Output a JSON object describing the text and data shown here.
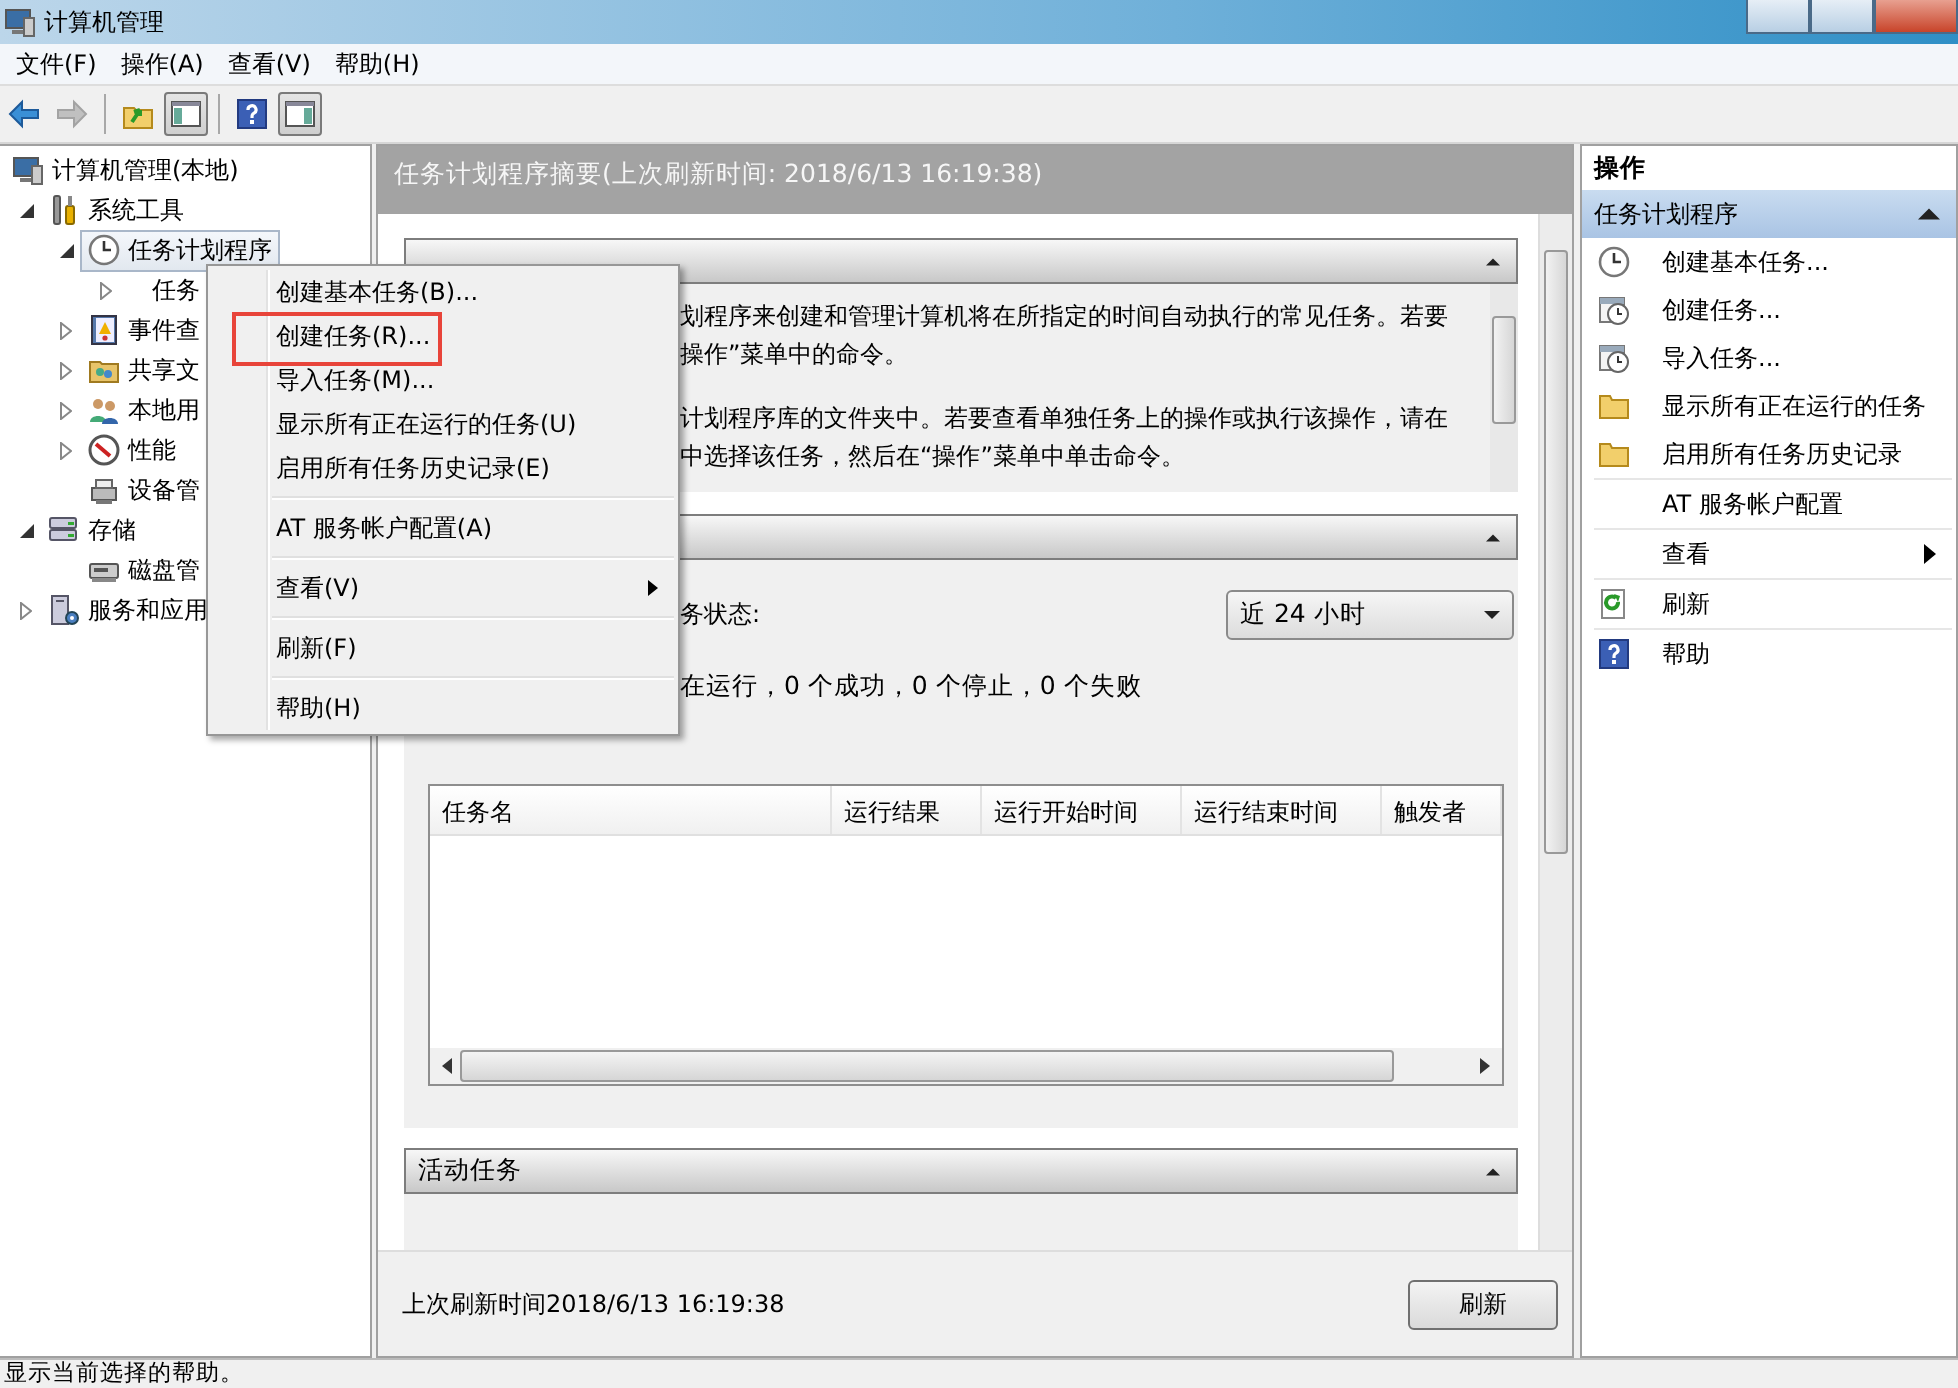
{
  "window": {
    "title": "计算机管理"
  },
  "menu_bar": [
    "文件(F)",
    "操作(A)",
    "查看(V)",
    "帮助(H)"
  ],
  "toolbar": [
    {
      "kind": "back",
      "disabled": false,
      "pressed": false
    },
    {
      "kind": "forward",
      "disabled": true,
      "pressed": false
    },
    {
      "kind": "separator"
    },
    {
      "kind": "up",
      "disabled": false,
      "pressed": false
    },
    {
      "kind": "tree-toggle",
      "disabled": false,
      "pressed": true
    },
    {
      "kind": "separator"
    },
    {
      "kind": "help",
      "disabled": false,
      "pressed": false
    },
    {
      "kind": "pane-toggle",
      "disabled": false,
      "pressed": true
    }
  ],
  "tree": [
    {
      "label": "计算机管理(本地)",
      "selected": false,
      "children": [
        {
          "label": "系统工具",
          "expanded": true,
          "selected": false,
          "children": [
            {
              "label": "任务计划程序",
              "expanded": true,
              "selected": true,
              "children": [
                {
                  "label": "任务",
                  "expanded": false,
                  "selected": false
                }
              ]
            },
            {
              "label": "事件查",
              "expanded": false,
              "selected": false
            },
            {
              "label": "共享文",
              "expanded": false,
              "selected": false
            },
            {
              "label": "本地用",
              "expanded": false,
              "selected": false
            },
            {
              "label": "性能",
              "expanded": false,
              "selected": false
            },
            {
              "label": "设备管",
              "selected": false
            }
          ]
        },
        {
          "label": "存储",
          "expanded": true,
          "selected": false,
          "children": [
            {
              "label": "磁盘管",
              "selected": false
            }
          ]
        },
        {
          "label": "服务和应用",
          "expanded": false,
          "selected": false
        }
      ]
    }
  ],
  "summary": {
    "title": "任务计划程序摘要(上次刷新时间: 2018/6/13 16:19:38)",
    "sections": [
      {
        "kind": "overview",
        "expanded": true,
        "paragraphs": [
          [
            "划程序来创建和管理计算机将在所指定的时间自动执行的常见任务。若要",
            "操作”菜单中的命令。"
          ],
          [
            "计划程序库的文件夹中。若要查看单独任务上的操作或执行该操作，请在",
            "中选择该任务，然后在“操作”菜单中单击命令。"
          ]
        ]
      },
      {
        "kind": "status",
        "expanded": true,
        "status_label": "务状态:",
        "period": "近 24 小时",
        "status_text": "在运行，0 个成功，0 个停止，0 个失败",
        "table": {
          "columns": [
            "任务名",
            "运行结果",
            "运行开始时间",
            "运行结束时间",
            "触发者"
          ]
        }
      },
      {
        "kind": "active",
        "expanded": true,
        "title": "活动任务"
      }
    ]
  },
  "footer": {
    "refreshed": "上次刷新时间2018/6/13 16:19:38",
    "button": "刷新"
  },
  "actions": {
    "title": "操作",
    "section": {
      "title": "任务计划程序",
      "expanded": true
    },
    "items": [
      {
        "kind": "item",
        "label": "创建基本任务..."
      },
      {
        "kind": "item",
        "label": "创建任务..."
      },
      {
        "kind": "item",
        "label": "导入任务..."
      },
      {
        "kind": "item",
        "label": "显示所有正在运行的任务"
      },
      {
        "kind": "item",
        "label": "启用所有任务历史记录"
      },
      {
        "kind": "separator"
      },
      {
        "kind": "item",
        "label": "AT 服务帐户配置"
      },
      {
        "kind": "separator"
      },
      {
        "kind": "submenu",
        "label": "查看"
      },
      {
        "kind": "separator"
      },
      {
        "kind": "item",
        "label": "刷新"
      },
      {
        "kind": "separator"
      },
      {
        "kind": "item",
        "label": "帮助"
      }
    ]
  },
  "context_menu": {
    "items": [
      {
        "kind": "item",
        "label": "创建基本任务(B)...",
        "highlighted": false
      },
      {
        "kind": "item",
        "label": "创建任务(R)...",
        "highlighted": true
      },
      {
        "kind": "item",
        "label": "导入任务(M)...",
        "highlighted": false
      },
      {
        "kind": "item",
        "label": "显示所有正在运行的任务(U)",
        "highlighted": false
      },
      {
        "kind": "item",
        "label": "启用所有任务历史记录(E)",
        "highlighted": false
      },
      {
        "kind": "separator"
      },
      {
        "kind": "item",
        "label": "AT 服务帐户配置(A)",
        "highlighted": false
      },
      {
        "kind": "separator"
      },
      {
        "kind": "submenu",
        "label": "查看(V)",
        "highlighted": false
      },
      {
        "kind": "separator"
      },
      {
        "kind": "item",
        "label": "刷新(F)",
        "highlighted": false
      },
      {
        "kind": "separator"
      },
      {
        "kind": "item",
        "label": "帮助(H)",
        "highlighted": false
      }
    ]
  },
  "status_bar": "显示当前选择的帮助。"
}
